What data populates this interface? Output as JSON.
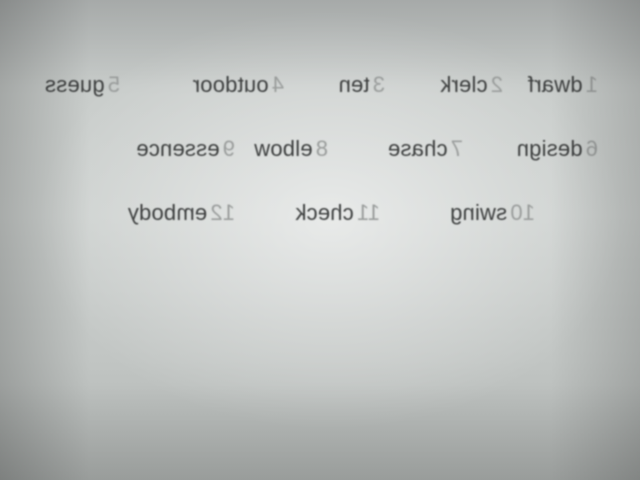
{
  "word_list": {
    "row1": [
      {
        "number": "1",
        "word": "dwarf"
      },
      {
        "number": "2",
        "word": "clerk"
      },
      {
        "number": "3",
        "word": "ten"
      },
      {
        "number": "4",
        "word": "outdoor"
      },
      {
        "number": "5",
        "word": "guess"
      }
    ],
    "row2": [
      {
        "number": "6",
        "word": "design"
      },
      {
        "number": "7",
        "word": "chase"
      },
      {
        "number": "8",
        "word": "elbow"
      },
      {
        "number": "9",
        "word": "essence"
      }
    ],
    "row3": [
      {
        "number": "10",
        "word": "swing"
      },
      {
        "number": "11",
        "word": "check"
      },
      {
        "number": "12",
        "word": "embody"
      }
    ]
  }
}
